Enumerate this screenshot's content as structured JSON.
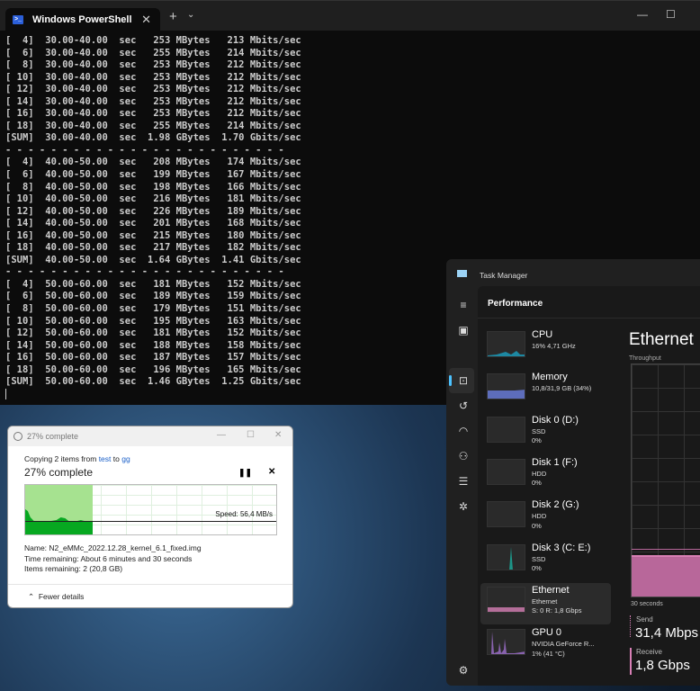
{
  "powershell": {
    "tab_title": "Windows PowerShell",
    "lines": [
      "[  4]  30.00-40.00  sec   253 MBytes   213 Mbits/sec",
      "[  6]  30.00-40.00  sec   255 MBytes   214 Mbits/sec",
      "[  8]  30.00-40.00  sec   253 MBytes   212 Mbits/sec",
      "[ 10]  30.00-40.00  sec   253 MBytes   212 Mbits/sec",
      "[ 12]  30.00-40.00  sec   253 MBytes   212 Mbits/sec",
      "[ 14]  30.00-40.00  sec   253 MBytes   212 Mbits/sec",
      "[ 16]  30.00-40.00  sec   253 MBytes   212 Mbits/sec",
      "[ 18]  30.00-40.00  sec   255 MBytes   214 Mbits/sec",
      "[SUM]  30.00-40.00  sec  1.98 GBytes  1.70 Gbits/sec",
      "- - - - - - - - - - - - - - - - - - - - - - - - -",
      "[  4]  40.00-50.00  sec   208 MBytes   174 Mbits/sec",
      "[  6]  40.00-50.00  sec   199 MBytes   167 Mbits/sec",
      "[  8]  40.00-50.00  sec   198 MBytes   166 Mbits/sec",
      "[ 10]  40.00-50.00  sec   216 MBytes   181 Mbits/sec",
      "[ 12]  40.00-50.00  sec   226 MBytes   189 Mbits/sec",
      "[ 14]  40.00-50.00  sec   201 MBytes   168 Mbits/sec",
      "[ 16]  40.00-50.00  sec   215 MBytes   180 Mbits/sec",
      "[ 18]  40.00-50.00  sec   217 MBytes   182 Mbits/sec",
      "[SUM]  40.00-50.00  sec  1.64 GBytes  1.41 Gbits/sec",
      "- - - - - - - - - - - - - - - - - - - - - - - - -",
      "[  4]  50.00-60.00  sec   181 MBytes   152 Mbits/sec",
      "[  6]  50.00-60.00  sec   189 MBytes   159 Mbits/sec",
      "[  8]  50.00-60.00  sec   179 MBytes   151 Mbits/sec",
      "[ 10]  50.00-60.00  sec   195 MBytes   163 Mbits/sec",
      "[ 12]  50.00-60.00  sec   181 MBytes   152 Mbits/sec",
      "[ 14]  50.00-60.00  sec   188 MBytes   158 Mbits/sec",
      "[ 16]  50.00-60.00  sec   187 MBytes   157 Mbits/sec",
      "[ 18]  50.00-60.00  sec   196 MBytes   165 Mbits/sec",
      "[SUM]  50.00-60.00  sec  1.46 GBytes  1.25 Gbits/sec"
    ]
  },
  "copy": {
    "title": "27% complete",
    "copying_prefix": "Copying 2 items from",
    "source": "test",
    "to": "to",
    "dest": "gg",
    "progress_label": "27% complete",
    "progress_percent": 27,
    "speed": "Speed: 56,4 MB/s",
    "name": "Name:  N2_eMMc_2022.12.28_kernel_6.1_fixed.img",
    "time_remaining": "Time remaining:  About 6 minutes and 30 seconds",
    "items_remaining": "Items remaining:  2 (20,8 GB)",
    "fewer_details": "Fewer details"
  },
  "taskmanager": {
    "title": "Task Manager",
    "section": "Performance",
    "items": [
      {
        "name": "CPU",
        "sub": [
          "16%  4,71 GHz"
        ],
        "color": "#1aa0c0"
      },
      {
        "name": "Memory",
        "sub": [
          "10,8/31,9 GB (34%)"
        ],
        "color": "#6a7ee0"
      },
      {
        "name": "Disk 0 (D:)",
        "sub": [
          "SSD",
          "0%"
        ],
        "color": "#1a9a8a"
      },
      {
        "name": "Disk 1 (F:)",
        "sub": [
          "HDD",
          "0%"
        ],
        "color": "#1a9a8a"
      },
      {
        "name": "Disk 2 (G:)",
        "sub": [
          "HDD",
          "0%"
        ],
        "color": "#1a9a8a"
      },
      {
        "name": "Disk 3 (C: E:)",
        "sub": [
          "SSD",
          "0%"
        ],
        "color": "#1ab0a0"
      },
      {
        "name": "Ethernet",
        "sub": [
          "Ethernet",
          "S: 0  R: 1,8 Gbps"
        ],
        "color": "#d77fb5"
      },
      {
        "name": "GPU 0",
        "sub": [
          "NVIDIA GeForce R...",
          "1%  (41 °C)"
        ],
        "color": "#a070d0"
      }
    ],
    "detail": {
      "title": "Ethernet",
      "throughput": "Throughput",
      "time_span": "30 seconds",
      "send_label": "Send",
      "send_value": "31,4 Mbps",
      "receive_label": "Receive",
      "receive_value": "1,8 Gbps"
    }
  }
}
